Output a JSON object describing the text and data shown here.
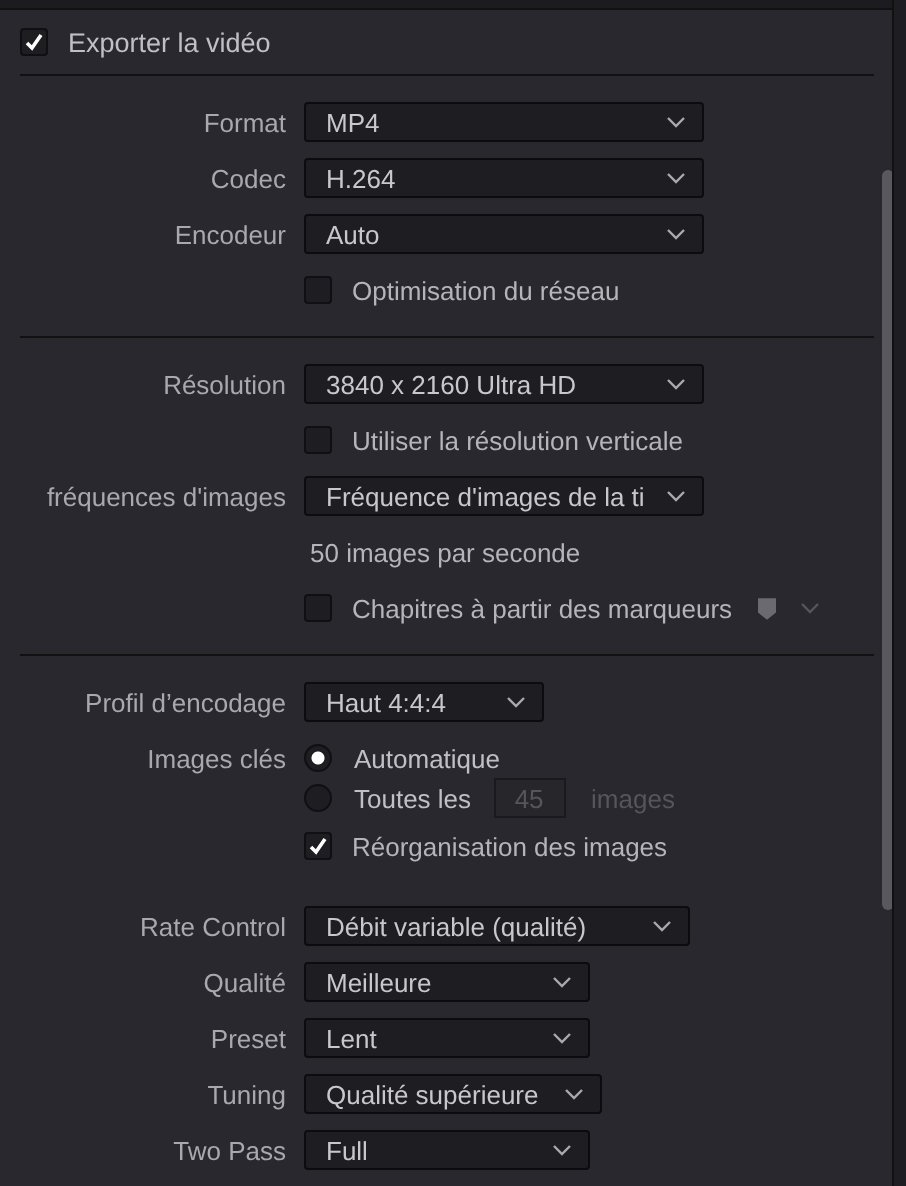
{
  "export": {
    "label": "Exporter la vidéo",
    "checked": true
  },
  "sections": [
    {
      "groups": [
        {
          "rows": [
            {
              "kind": "select",
              "label": "Format",
              "value": "MP4"
            },
            {
              "kind": "select",
              "label": "Codec",
              "value": "H.264"
            },
            {
              "kind": "select",
              "label": "Encodeur",
              "value": "Auto"
            },
            {
              "kind": "checkbox",
              "label": "Optimisation du réseau",
              "checked": false
            }
          ]
        }
      ]
    },
    {
      "groups": [
        {
          "rows": [
            {
              "kind": "select",
              "label": "Résolution",
              "value": "3840 x 2160 Ultra HD"
            },
            {
              "kind": "checkbox",
              "label": "Utiliser la résolution verticale",
              "checked": false
            },
            {
              "kind": "select",
              "label": "fréquences d'images",
              "value": "Fréquence d'images de la ti"
            },
            {
              "kind": "note",
              "text": "50 images par seconde"
            },
            {
              "kind": "checkbox",
              "label": "Chapitres à partir des marqueurs",
              "checked": false,
              "marker": true
            }
          ]
        }
      ]
    },
    {
      "groups": [
        {
          "rows": [
            {
              "kind": "select",
              "label": "Profil d’encodage",
              "value": "Haut 4:4:4"
            },
            {
              "kind": "radio",
              "label": "Images clés",
              "options": [
                {
                  "label": "Automatique",
                  "selected": true
                },
                {
                  "label": "Toutes les",
                  "selected": false,
                  "field": {
                    "value": "45",
                    "disabled": true
                  },
                  "suffix": "images"
                }
              ]
            },
            {
              "kind": "checkbox",
              "label": "Réorganisation des images",
              "checked": true
            }
          ]
        },
        {
          "rows": [
            {
              "kind": "select",
              "label": "Rate Control",
              "value": "Débit variable (qualité)"
            },
            {
              "kind": "select",
              "label": "Qualité",
              "value": "Meilleure"
            },
            {
              "kind": "select",
              "label": "Preset",
              "value": "Lent"
            },
            {
              "kind": "select",
              "label": "Tuning",
              "value": "Qualité supérieure"
            },
            {
              "kind": "select",
              "label": "Two Pass",
              "value": "Full"
            }
          ]
        }
      ]
    }
  ]
}
